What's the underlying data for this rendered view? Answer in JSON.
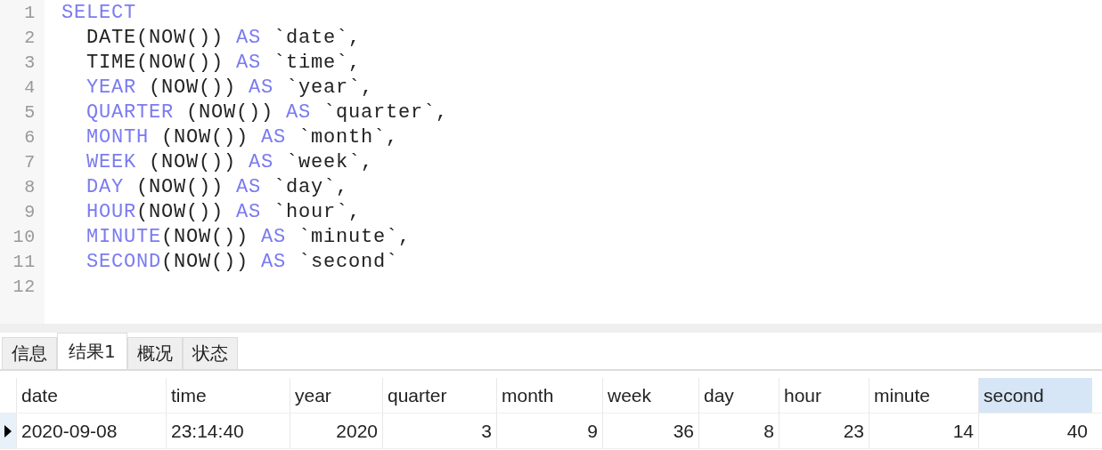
{
  "editor": {
    "lines": [
      {
        "number": "1",
        "tokens": [
          {
            "text": "SELECT",
            "kind": "keyword"
          }
        ]
      },
      {
        "number": "2",
        "indent": true,
        "tokens": [
          {
            "text": "DATE(NOW()) ",
            "kind": "plain"
          },
          {
            "text": "AS",
            "kind": "keyword"
          },
          {
            "text": " `date`,",
            "kind": "plain"
          }
        ]
      },
      {
        "number": "3",
        "indent": true,
        "tokens": [
          {
            "text": "TIME(NOW()) ",
            "kind": "plain"
          },
          {
            "text": "AS",
            "kind": "keyword"
          },
          {
            "text": " `time`,",
            "kind": "plain"
          }
        ]
      },
      {
        "number": "4",
        "indent": true,
        "tokens": [
          {
            "text": "YEAR",
            "kind": "keyword"
          },
          {
            "text": " (NOW()) ",
            "kind": "plain"
          },
          {
            "text": "AS",
            "kind": "keyword"
          },
          {
            "text": " `year`,",
            "kind": "plain"
          }
        ]
      },
      {
        "number": "5",
        "indent": true,
        "tokens": [
          {
            "text": "QUARTER",
            "kind": "keyword"
          },
          {
            "text": " (NOW()) ",
            "kind": "plain"
          },
          {
            "text": "AS",
            "kind": "keyword"
          },
          {
            "text": " `quarter`,",
            "kind": "plain"
          }
        ]
      },
      {
        "number": "6",
        "indent": true,
        "tokens": [
          {
            "text": "MONTH",
            "kind": "keyword"
          },
          {
            "text": " (NOW()) ",
            "kind": "plain"
          },
          {
            "text": "AS",
            "kind": "keyword"
          },
          {
            "text": " `month`,",
            "kind": "plain"
          }
        ]
      },
      {
        "number": "7",
        "indent": true,
        "tokens": [
          {
            "text": "WEEK",
            "kind": "keyword"
          },
          {
            "text": " (NOW()) ",
            "kind": "plain"
          },
          {
            "text": "AS",
            "kind": "keyword"
          },
          {
            "text": " `week`,",
            "kind": "plain"
          }
        ]
      },
      {
        "number": "8",
        "indent": true,
        "tokens": [
          {
            "text": "DAY",
            "kind": "keyword"
          },
          {
            "text": " (NOW()) ",
            "kind": "plain"
          },
          {
            "text": "AS",
            "kind": "keyword"
          },
          {
            "text": " `day`,",
            "kind": "plain"
          }
        ]
      },
      {
        "number": "9",
        "indent": true,
        "tokens": [
          {
            "text": "HOUR",
            "kind": "keyword"
          },
          {
            "text": "(NOW()) ",
            "kind": "plain"
          },
          {
            "text": "AS",
            "kind": "keyword"
          },
          {
            "text": " `hour`,",
            "kind": "plain"
          }
        ]
      },
      {
        "number": "10",
        "indent": true,
        "tokens": [
          {
            "text": "MINUTE",
            "kind": "keyword"
          },
          {
            "text": "(NOW()) ",
            "kind": "plain"
          },
          {
            "text": "AS",
            "kind": "keyword"
          },
          {
            "text": " `minute`,",
            "kind": "plain"
          }
        ]
      },
      {
        "number": "11",
        "indent": true,
        "tokens": [
          {
            "text": "SECOND",
            "kind": "keyword"
          },
          {
            "text": "(NOW()) ",
            "kind": "plain"
          },
          {
            "text": "AS",
            "kind": "keyword"
          },
          {
            "text": " `second`",
            "kind": "plain"
          }
        ]
      },
      {
        "number": "12"
      }
    ]
  },
  "tabs": [
    {
      "label": "信息",
      "selected": false
    },
    {
      "label": "结果1",
      "selected": true
    },
    {
      "label": "概况",
      "selected": false
    },
    {
      "label": "状态",
      "selected": false
    }
  ],
  "table": {
    "columns": [
      {
        "label": "date",
        "kind": "text",
        "selected": false
      },
      {
        "label": "time",
        "kind": "text",
        "selected": false
      },
      {
        "label": "year",
        "kind": "number",
        "selected": false
      },
      {
        "label": "quarter",
        "kind": "number",
        "selected": false
      },
      {
        "label": "month",
        "kind": "number",
        "selected": false
      },
      {
        "label": "week",
        "kind": "number",
        "selected": false
      },
      {
        "label": "day",
        "kind": "number",
        "selected": false
      },
      {
        "label": "hour",
        "kind": "number",
        "selected": false
      },
      {
        "label": "minute",
        "kind": "number",
        "selected": false
      },
      {
        "label": "second",
        "kind": "number",
        "selected": true
      }
    ],
    "rows": [
      {
        "current": true,
        "cells": [
          "2020-09-08",
          "23:14:40",
          "2020",
          "3",
          "9",
          "36",
          "8",
          "23",
          "14",
          "40"
        ]
      }
    ]
  }
}
